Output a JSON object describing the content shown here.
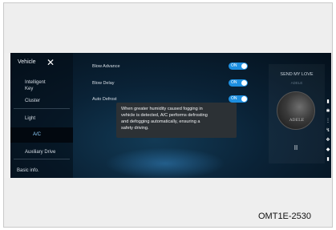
{
  "sidebar": {
    "title": "Vehicle",
    "items": [
      "Intelligent Key",
      "Cluster",
      "Light",
      "A/C",
      "Auxiliary Drive",
      "Basic info."
    ],
    "active_item": "A/C"
  },
  "settings": {
    "rows": [
      {
        "label": "Blow Advance",
        "toggle": "ON"
      },
      {
        "label": "Blow Delay",
        "toggle": "ON"
      },
      {
        "label": "Auto Defrost",
        "toggle": "ON"
      }
    ],
    "tooltip_lines": [
      "When greater humidity caused fogging in",
      "vehicle is detected, A/C performs defrosting",
      "and defogging automatically, ensuring a",
      "safety driving."
    ]
  },
  "media": {
    "song": "SEND MY LOVE",
    "artist": "ADELE",
    "pause_label": "II"
  },
  "figure_code": "OMT1E-2530",
  "colors": {
    "accent": "#1d8fe0",
    "active_text": "#8fd0ff",
    "screen_bg": "#0a2236"
  },
  "icons": [
    "close-icon",
    "pause-icon",
    "status-rail-icons"
  ]
}
